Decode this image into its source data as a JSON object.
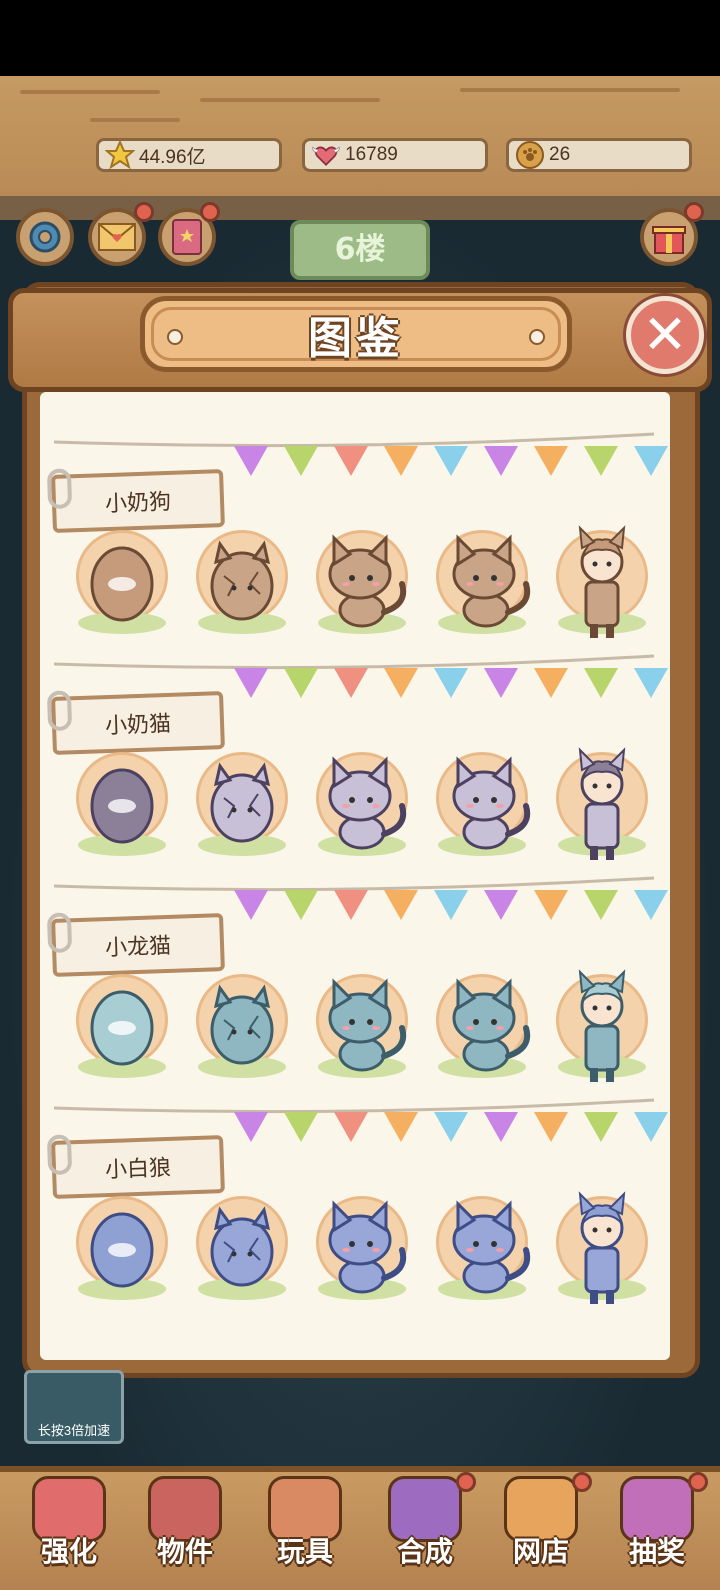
{
  "resources": {
    "stars": "44.96亿",
    "hearts": "16789",
    "coins": "26"
  },
  "floor_label": "6楼",
  "panel": {
    "title": "图鉴",
    "close_label": "✕"
  },
  "sections": [
    {
      "name": "小奶狗",
      "theme": "dog",
      "colors": {
        "body": "#c9a486",
        "line": "#6b4a35",
        "egg": "#c69b7c"
      }
    },
    {
      "name": "小奶猫",
      "theme": "cat",
      "colors": {
        "body": "#c8c0d6",
        "line": "#4c4160",
        "egg": "#8c7f98"
      }
    },
    {
      "name": "小龙猫",
      "theme": "dragon",
      "colors": {
        "body": "#8fb7c1",
        "line": "#3c5d69",
        "egg": "#a8cdd3"
      }
    },
    {
      "name": "小白狼",
      "theme": "wolf",
      "colors": {
        "body": "#98a7d7",
        "line": "#3e4d86",
        "egg": "#8fa0d2"
      }
    }
  ],
  "speedup_label": "长按3倍加速",
  "bottom_nav": [
    {
      "label": "强化",
      "icon": "lollipop-icon"
    },
    {
      "label": "物件",
      "icon": "piano-icon"
    },
    {
      "label": "玩具",
      "icon": "cat-house-icon"
    },
    {
      "label": "合成",
      "icon": "cards-icon"
    },
    {
      "label": "网店",
      "icon": "shop-basket-icon"
    },
    {
      "label": "抽奖",
      "icon": "lottery-wheel-icon"
    }
  ],
  "colors": {
    "wood": "#b98a55",
    "paper": "#fbf6ea",
    "accent_red": "#e0634f"
  }
}
